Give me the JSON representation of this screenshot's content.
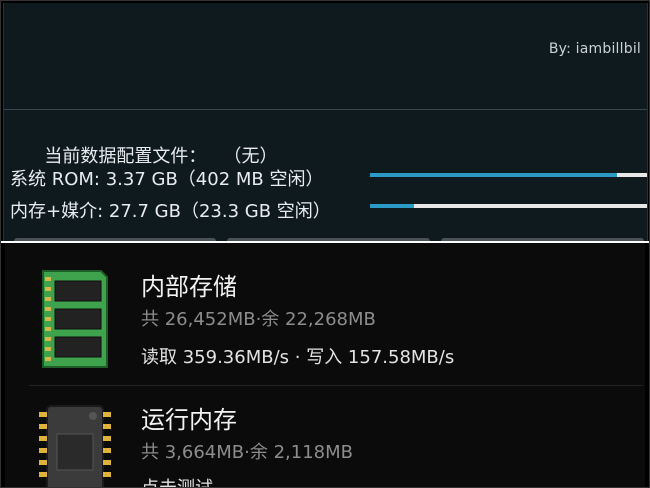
{
  "header": {
    "byline": "By:  iambillbil"
  },
  "profile": {
    "label": "当前数据配置文件：",
    "value": "（无）"
  },
  "storage_rows": [
    {
      "text": "系统 ROM: 3.37 GB（402 MB 空闲）",
      "used_fraction": 0.89
    },
    {
      "text": "内存+媒介: 27.7 GB（23.3 GB 空闲）",
      "used_fraction": 0.16
    }
  ],
  "cards": [
    {
      "title": "内部存储",
      "capacity": "共 26,452MB·余 22,268MB",
      "speed": "读取 359.36MB/s · 写入 157.58MB/s"
    },
    {
      "title": "运行内存",
      "capacity": "共 3,664MB·余 2,118MB",
      "speed": "点击测试"
    }
  ],
  "colors": {
    "accent": "#2b9ac7",
    "bar_track": "#e7e7e7",
    "chip_green": "#3fa34d",
    "chip_gold": "#e0b23a"
  }
}
